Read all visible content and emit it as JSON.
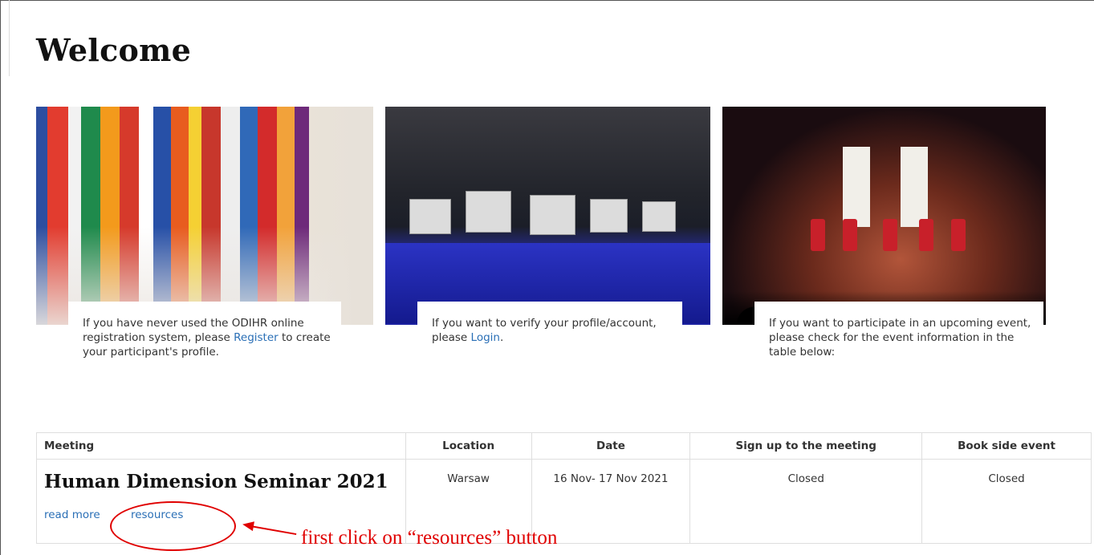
{
  "page": {
    "title": "Welcome"
  },
  "cards": [
    {
      "text_before": "If you have never used the ODIHR online registration system, please ",
      "link": "Register",
      "text_after": " to create your participant's profile.",
      "image": "flags-photo"
    },
    {
      "text_before": "If you want to verify your profile/account, please ",
      "link": "Login",
      "text_after": ".",
      "image": "conference-photo"
    },
    {
      "text_before": "If you want to participate in an upcoming event, please check for the event information in the table below:",
      "link": "",
      "text_after": "",
      "image": "stage-photo"
    }
  ],
  "table": {
    "headers": [
      "Meeting",
      "Location",
      "Date",
      "Sign up to the meeting",
      "Book side event"
    ],
    "rows": [
      {
        "meeting": "Human Dimension Seminar 2021",
        "read_more": "read more",
        "resources": "resources",
        "location": "Warsaw",
        "date": "16 Nov- 17 Nov 2021",
        "sign_up": "Closed",
        "side_event": "Closed"
      }
    ]
  },
  "annotation": {
    "text": "first click on “resources” button",
    "color": "#e00000"
  },
  "colors": {
    "link": "#2a6fb6",
    "heading": "#111111"
  }
}
